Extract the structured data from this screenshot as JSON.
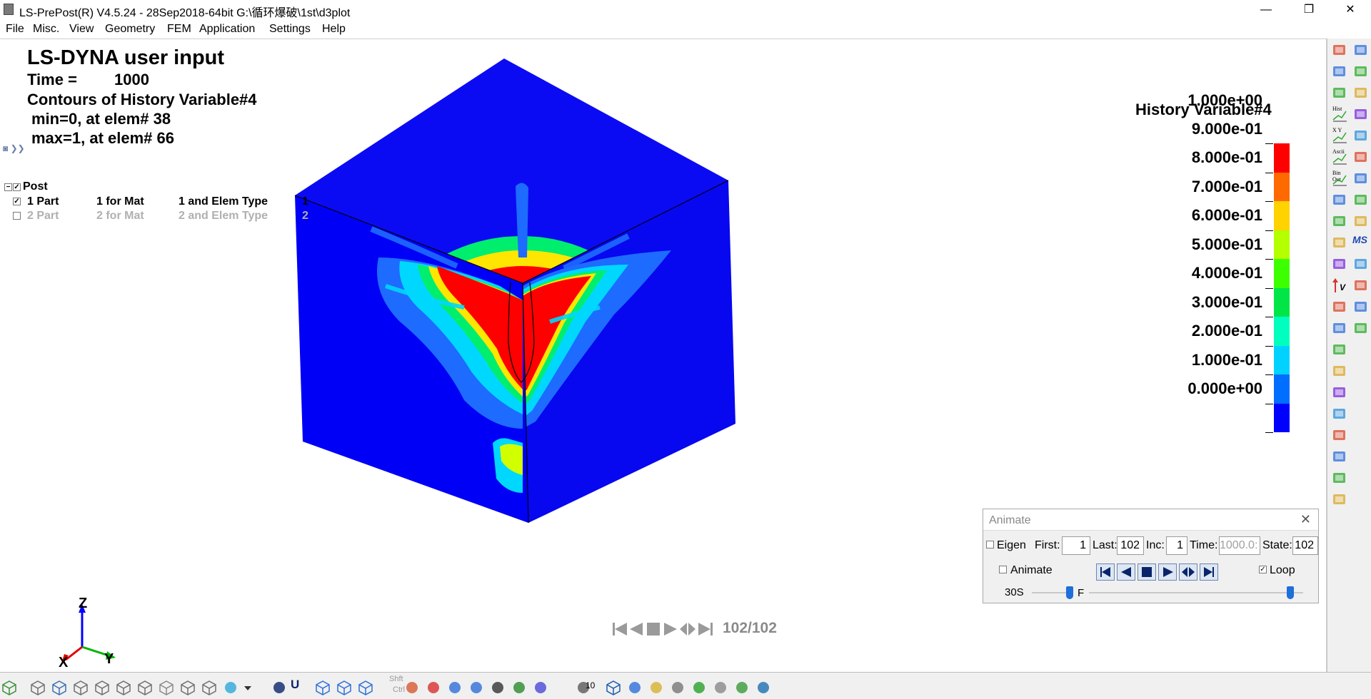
{
  "window": {
    "title": "LS-PrePost(R) V4.5.24 - 28Sep2018-64bit G:\\循环爆破\\1st\\d3plot",
    "minimize_glyph": "—",
    "maximize_glyph": "❐",
    "close_glyph": "✕"
  },
  "menu": [
    "File",
    "Misc.",
    "View",
    "Geometry",
    "FEM",
    "Application",
    "Settings",
    "Help"
  ],
  "overlay": {
    "heading": "LS-DYNA user input",
    "time_label": "Time =",
    "time_value": "1000",
    "contour_title": "Contours of History Variable#4",
    "min_line": "min=0, at elem# 38",
    "max_line": "max=1, at elem# 66"
  },
  "tree": {
    "root": "Post",
    "rows": [
      {
        "part": "1 Part",
        "mat": "1 for Mat",
        "etype": "1 and Elem Type",
        "num": "1",
        "checked": true,
        "dim": false
      },
      {
        "part": "2 Part",
        "mat": "2 for Mat",
        "etype": "2 and Elem Type",
        "num": "2",
        "checked": false,
        "dim": true
      }
    ]
  },
  "legend": {
    "title": "History Variable#4",
    "labels": [
      "1.000e+00",
      "9.000e-01",
      "8.000e-01",
      "7.000e-01",
      "6.000e-01",
      "5.000e-01",
      "4.000e-01",
      "3.000e-01",
      "2.000e-01",
      "1.000e-01",
      "0.000e+00"
    ],
    "colors": [
      "#ff0000",
      "#ff6a00",
      "#ffd200",
      "#b4ff00",
      "#3cff00",
      "#00e646",
      "#00ffbe",
      "#00d2ff",
      "#006eff",
      "#0000ff"
    ]
  },
  "axes": {
    "z": "Z",
    "x": "X",
    "y": "Y"
  },
  "playback": {
    "state": "102/102"
  },
  "animate_panel": {
    "title": "Animate",
    "close_glyph": "✕",
    "eigen_label": "Eigen",
    "first_label": "First:",
    "first_value": "1",
    "last_label": "Last:",
    "last_value": "102",
    "inc_label": "Inc:",
    "inc_value": "1",
    "time_label": "Time:",
    "time_value": "1000.0:",
    "state_label": "State:",
    "state_value": "102",
    "animate_label": "Animate",
    "loop_label": "Loop",
    "loop_checked": true,
    "speed_label": "30S",
    "f_label": "F"
  },
  "statusbar": {
    "shft_label": "Shft",
    "ctrl_label": "Ctrl",
    "u_label": "U",
    "count_label": "10",
    "icons": [
      "model-icon",
      "wire-cube-icon",
      "shaded-cube-icon",
      "hidden-cube-icon",
      "mesh-cube-icon",
      "outline-cube-icon",
      "edge-cube-icon",
      "points-cube-icon",
      "grid-cube-icon",
      "grid-cube-2-icon",
      "contour-icon",
      "dropdown-icon",
      "select-icon",
      "front-cube-icon",
      "solid-cube-icon",
      "frame-cube-icon",
      "pencil-icon",
      "add-icon",
      "zoom-box-icon",
      "zoom-icon",
      "rotate-icon",
      "globe-icon",
      "sphere-icon",
      "axis-icon",
      "blue-cube-icon",
      "home-icon",
      "light-icon",
      "checker-icon",
      "color-icon",
      "gear-icon",
      "refresh-icon",
      "picture-icon"
    ]
  },
  "sidebar": {
    "labels": [
      "Hist",
      "X Y",
      "Ascii",
      "Bin Out",
      "MS",
      "V"
    ]
  }
}
